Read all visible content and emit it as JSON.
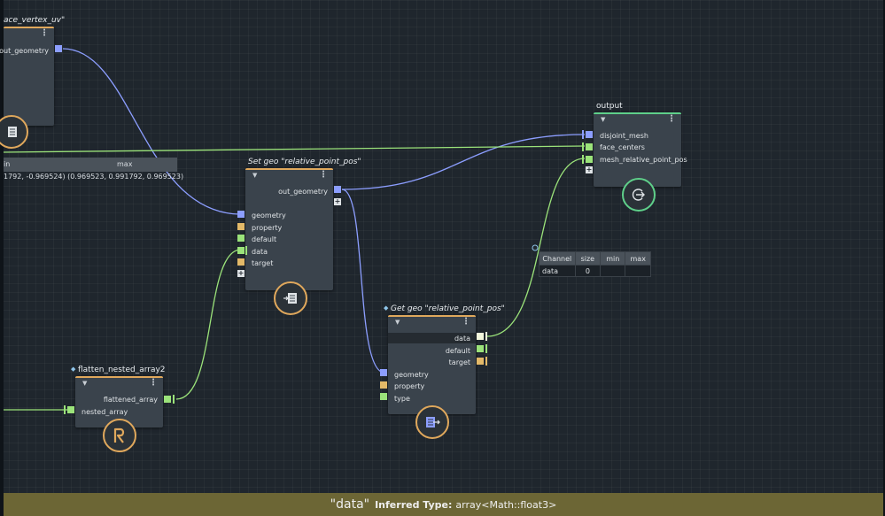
{
  "nodes": {
    "face_vertex_uv": {
      "title": "ace_vertex_uv\"",
      "outputs": [
        "out_geometry"
      ]
    },
    "set_geo": {
      "title": "Set geo \"relative_point_pos\"",
      "outputs": [
        "out_geometry"
      ],
      "inputs": [
        "geometry",
        "property",
        "default",
        "data",
        "target"
      ]
    },
    "get_geo": {
      "title": "Get geo \"relative_point_pos\"",
      "outputs": [
        "data",
        "default",
        "target"
      ],
      "inputs": [
        "geometry",
        "property",
        "type"
      ]
    },
    "flatten": {
      "title": "flatten_nested_array2",
      "outputs": [
        "flattened_array"
      ],
      "inputs": [
        "nested_array"
      ]
    },
    "output": {
      "title": "output",
      "inputs": [
        "disjoint_mesh",
        "face_centers",
        "mesh_relative_point_pos"
      ]
    }
  },
  "bounds_table": {
    "headers": [
      "in",
      "max"
    ],
    "row": [
      "1792, -0.969524)",
      "(0.969523, 0.991792, 0.969523)"
    ]
  },
  "channel_table": {
    "headers": [
      "Channel",
      "size",
      "min",
      "max"
    ],
    "rows": [
      [
        "data",
        "0",
        "",
        ""
      ]
    ]
  },
  "status_bar": {
    "name": "\"data\"",
    "label": "Inferred Type:",
    "type": "array<Math::float3>"
  },
  "colors": {
    "geometry_port": "#8c9eff",
    "attribute_port": "#e3b968",
    "data_port": "#9be37a",
    "node_accent": "#e0a85c",
    "output_accent": "#5fd08a",
    "status_bar": "#6c6635"
  },
  "icons": {
    "face_vertex_uv": "document-lines-icon",
    "set_geo": "set-attribute-icon",
    "get_geo": "get-attribute-icon",
    "flatten": "r-logo-icon",
    "output": "arrow-right-circle-icon"
  }
}
